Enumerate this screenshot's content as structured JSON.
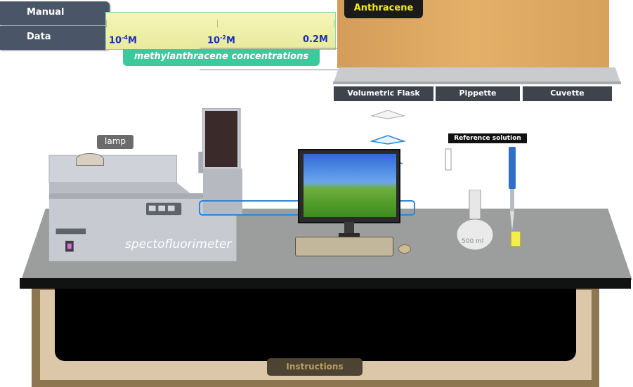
{
  "menu": {
    "manual_label": "Manual",
    "data_label": "Data"
  },
  "concentration": {
    "ticks": [
      {
        "base": "10",
        "exp": "-4",
        "unit": "M"
      },
      {
        "base": "10",
        "exp": "-2",
        "unit": "M"
      },
      {
        "base": "0.2",
        "exp": "",
        "unit": "M"
      }
    ],
    "label": "methylanthracene concentrations"
  },
  "shelf": {
    "title": "Anthracene",
    "tabs": [
      "Volumetric Flask",
      "Pippette",
      "Cuvette"
    ]
  },
  "apparatus": {
    "lamp_label": "lamp",
    "instrument_label": "spectofluorimeter",
    "reference_label": "Reference solution",
    "flask_volume": "500 ml"
  },
  "footer": {
    "instructions_label": "Instructions"
  },
  "colors": {
    "menu": "#4a5567",
    "slider_bg": "#f1f2a8",
    "slider_label_bg": "#3cc99b",
    "tick_text": "#1a2fb8",
    "shelf_title_text": "#f5ea16",
    "tab_bg": "#3f434b",
    "cabinet": "#8e7651"
  }
}
